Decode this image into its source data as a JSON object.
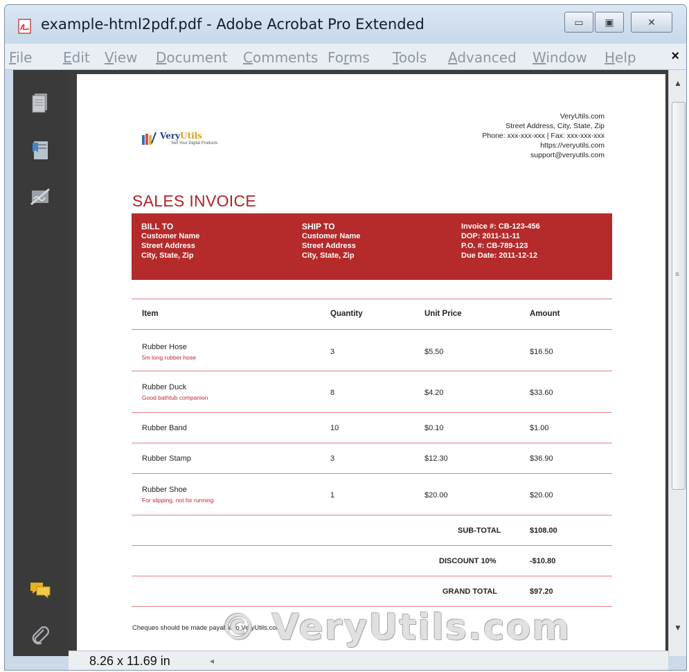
{
  "window": {
    "title": "example-html2pdf.pdf - Adobe Acrobat Pro Extended",
    "min_glyph": "▭",
    "max_glyph": "▣",
    "close_glyph": "✕"
  },
  "menubar": {
    "items": [
      {
        "accel": "F",
        "rest": "ile"
      },
      {
        "accel": "E",
        "rest": "dit"
      },
      {
        "accel": "V",
        "rest": "iew"
      },
      {
        "accel": "D",
        "rest": "ocument"
      },
      {
        "accel": "C",
        "rest": "omments"
      },
      {
        "pre": "Fo",
        "accel": "r",
        "rest": "ms"
      },
      {
        "accel": "T",
        "rest": "ools"
      },
      {
        "accel": "A",
        "rest": "dvanced"
      },
      {
        "accel": "W",
        "rest": "indow"
      },
      {
        "accel": "H",
        "rest": "elp"
      }
    ],
    "close": "×"
  },
  "navpane": {
    "icons": [
      "pages-icon",
      "bookmarks-icon",
      "signatures-icon",
      "comments-icon",
      "attachments-icon"
    ]
  },
  "statusbar": {
    "page_size": "8.26 x 11.69 in",
    "scroll_left": "◂"
  },
  "invoice": {
    "logo_brand_a": "Very",
    "logo_brand_b": "Utils",
    "logo_tagline": "Sell Your Digital Products",
    "company": {
      "name": "VeryUtils.com",
      "address": "Street Address, City, State, Zip",
      "phone": "Phone: xxx-xxx-xxx | Fax: xxx-xxx-xxx",
      "url": "https://veryutils.com",
      "email": "support@veryutils.com"
    },
    "title": "SALES INVOICE",
    "bill_to": {
      "label": "BILL TO",
      "name": "Customer Name",
      "street": "Street Address",
      "city": "City, State, Zip"
    },
    "ship_to": {
      "label": "SHIP TO",
      "name": "Customer Name",
      "street": "Street Address",
      "city": "City, State, Zip"
    },
    "meta": {
      "invoice": "Invoice #: CB-123-456",
      "dop": "DOP: 2011-11-11",
      "po": "P.O. #: CB-789-123",
      "due": "Due Date: 2011-12-12"
    },
    "columns": {
      "item": "Item",
      "quantity": "Quantity",
      "unit_price": "Unit Price",
      "amount": "Amount"
    },
    "rows": [
      {
        "item": "Rubber Hose",
        "desc": "5m long rubber hose",
        "qty": "3",
        "price": "$5.50",
        "amount": "$16.50"
      },
      {
        "item": "Rubber Duck",
        "desc": "Good bathtub companion",
        "qty": "8",
        "price": "$4.20",
        "amount": "$33.60"
      },
      {
        "item": "Rubber Band",
        "desc": "",
        "qty": "10",
        "price": "$0.10",
        "amount": "$1.00"
      },
      {
        "item": "Rubber Stamp",
        "desc": "",
        "qty": "3",
        "price": "$12.30",
        "amount": "$36.90"
      },
      {
        "item": "Rubber Shoe",
        "desc": "For slipping, not for running",
        "qty": "1",
        "price": "$20.00",
        "amount": "$20.00"
      }
    ],
    "totals": {
      "subtotal_label": "SUB-TOTAL",
      "subtotal": "$108.00",
      "discount_label": "DISCOUNT 10%",
      "discount": "-$10.80",
      "grand_label": "GRAND TOTAL",
      "grand": "$97.20"
    },
    "footer": "Cheques should be made payable to VeryUtils.com"
  },
  "watermark": "© VeryUtils.com",
  "colors": {
    "accent": "#b52a2a",
    "rule": "#e37f82",
    "frame": "#ccd9e8"
  }
}
